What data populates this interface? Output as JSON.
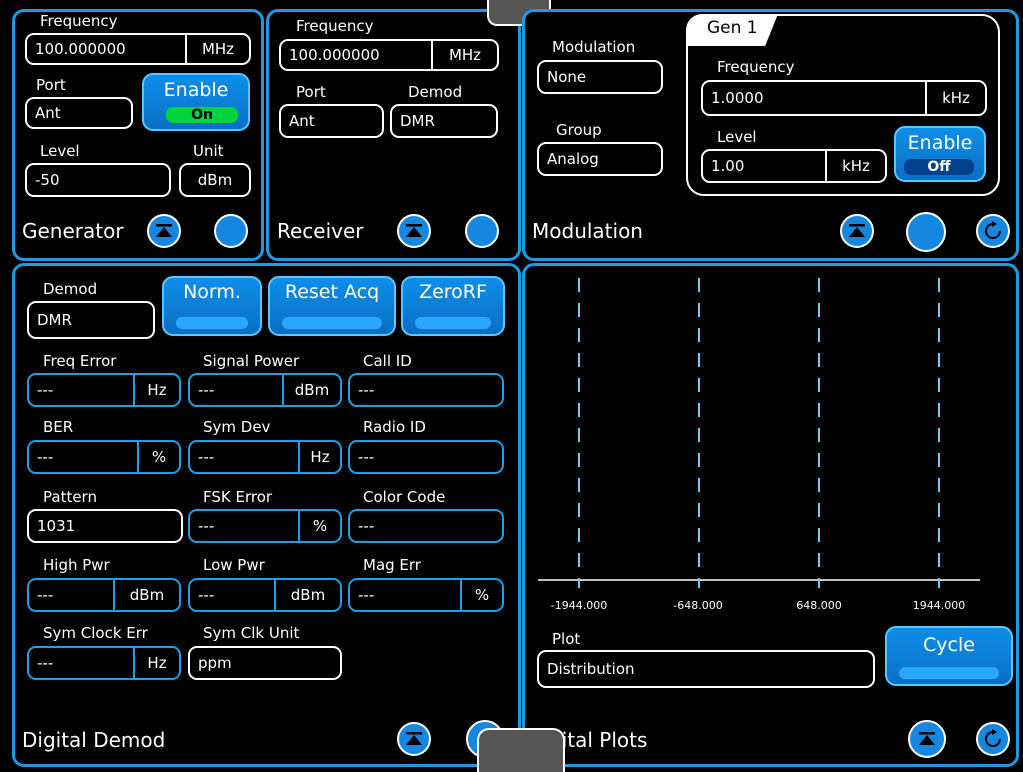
{
  "generator": {
    "title": "Generator",
    "frequency_label": "Frequency",
    "frequency_value": "100.000000",
    "frequency_unit": "MHz",
    "port_label": "Port",
    "port_value": "Ant",
    "enable_label": "Enable",
    "enable_state": "On",
    "level_label": "Level",
    "level_value": "-50",
    "unit_label": "Unit",
    "unit_value": "dBm"
  },
  "receiver": {
    "title": "Receiver",
    "frequency_label": "Frequency",
    "frequency_value": "100.000000",
    "frequency_unit": "MHz",
    "port_label": "Port",
    "port_value": "Ant",
    "demod_label": "Demod",
    "demod_value": "DMR"
  },
  "modulation": {
    "title": "Modulation",
    "modulation_label": "Modulation",
    "modulation_value": "None",
    "group_label": "Group",
    "group_value": "Analog",
    "gen_tab": "Gen 1",
    "frequency_label": "Frequency",
    "frequency_value": "1.0000",
    "frequency_unit": "kHz",
    "level_label": "Level",
    "level_value": "1.00",
    "level_unit": "kHz",
    "enable_label": "Enable",
    "enable_state": "Off"
  },
  "digital_demod": {
    "title": "Digital Demod",
    "demod_label": "Demod",
    "demod_value": "DMR",
    "buttons": {
      "norm": "Norm.",
      "reset": "Reset Acq",
      "zero": "ZeroRF"
    },
    "freq_error_label": "Freq Error",
    "freq_error_value": "---",
    "freq_error_unit": "Hz",
    "signal_power_label": "Signal Power",
    "signal_power_value": "---",
    "signal_power_unit": "dBm",
    "call_id_label": "Call ID",
    "call_id_value": "---",
    "ber_label": "BER",
    "ber_value": "---",
    "ber_unit": "%",
    "sym_dev_label": "Sym Dev",
    "sym_dev_value": "---",
    "sym_dev_unit": "Hz",
    "radio_id_label": "Radio ID",
    "radio_id_value": "---",
    "pattern_label": "Pattern",
    "pattern_value": "1031",
    "fsk_error_label": "FSK Error",
    "fsk_error_value": "---",
    "fsk_error_unit": "%",
    "color_code_label": "Color Code",
    "color_code_value": "---",
    "high_pwr_label": "High Pwr",
    "high_pwr_value": "---",
    "high_pwr_unit": "dBm",
    "low_pwr_label": "Low Pwr",
    "low_pwr_value": "---",
    "low_pwr_unit": "dBm",
    "mag_err_label": "Mag Err",
    "mag_err_value": "---",
    "mag_err_unit": "%",
    "sym_clock_err_label": "Sym Clock Err",
    "sym_clock_err_value": "---",
    "sym_clock_err_unit": "Hz",
    "sym_clk_unit_label": "Sym Clk Unit",
    "sym_clk_unit_value": "ppm"
  },
  "digital_plots": {
    "title": "gital Plots",
    "plot_label": "Plot",
    "plot_value": "Distribution",
    "cycle_label": "Cycle",
    "x_ticks": [
      "-1944.000",
      "-648.000",
      "648.000",
      "1944.000"
    ]
  },
  "colors": {
    "accent": "#1e9be0",
    "button": "#0a6fc4",
    "on": "#00d43a"
  }
}
